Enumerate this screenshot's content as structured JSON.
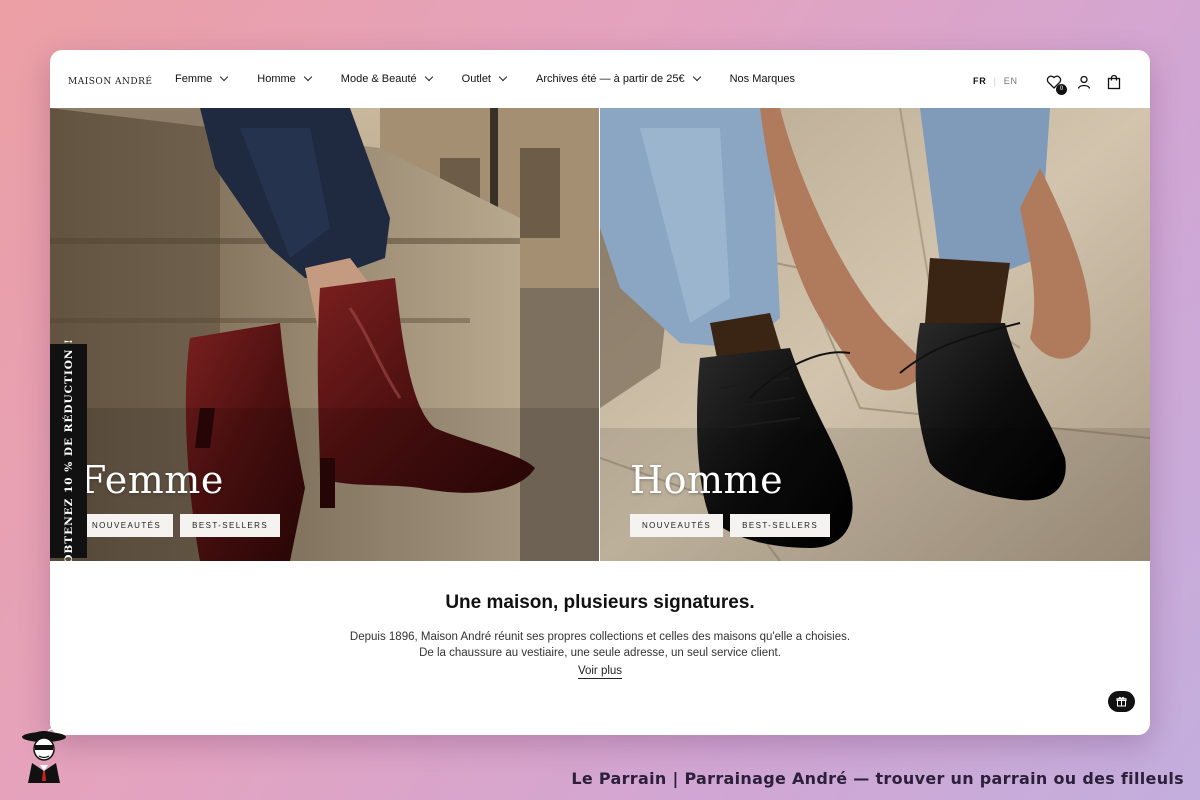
{
  "header": {
    "logo": "MAISON ANDRÉ",
    "nav": [
      {
        "label": "Femme",
        "has_dropdown": true
      },
      {
        "label": "Homme",
        "has_dropdown": true
      },
      {
        "label": "Mode & Beauté",
        "has_dropdown": true
      },
      {
        "label": "Outlet",
        "has_dropdown": true
      },
      {
        "label": "Archives été — à partir de 25€",
        "has_dropdown": true
      },
      {
        "label": "Nos Marques",
        "has_dropdown": false
      }
    ],
    "lang": {
      "current": "FR",
      "other": "EN"
    },
    "icons": [
      "wishlist-icon",
      "account-icon",
      "bag-icon"
    ],
    "wishlist_count": "0"
  },
  "hero": {
    "femme": {
      "title": "Femme",
      "buttons": [
        "NOUVEAUTÉS",
        "BEST-SELLERS"
      ]
    },
    "homme": {
      "title": "Homme",
      "buttons": [
        "NOUVEAUTÉS",
        "BEST-SELLERS"
      ]
    },
    "promo_tab": "OBTENEZ 10 % DE RÉDUCTION !"
  },
  "intro": {
    "heading": "Une maison, plusieurs signatures.",
    "line1": "Depuis 1896, Maison André réunit ses propres collections et celles des maisons qu'elle a choisies.",
    "line2": "De la chaussure au vestiaire, une seule adresse, un seul service client.",
    "link": "Voir plus"
  },
  "footer": {
    "caption": "Le Parrain | Parrainage André — trouver un parrain ou des filleuls"
  },
  "colors": {
    "accent": "#111111",
    "boot": "#5e1414",
    "denim_dark": "#24314a",
    "denim_light": "#8aa6c3"
  }
}
